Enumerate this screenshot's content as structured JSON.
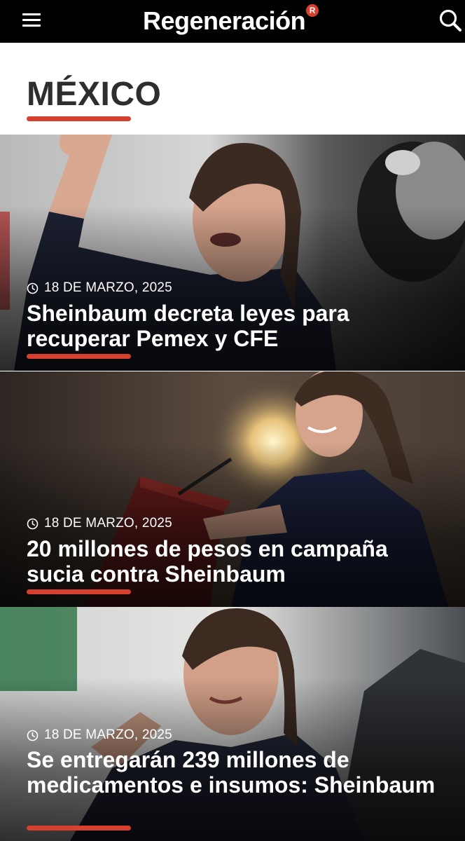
{
  "header": {
    "brand": "Regeneración",
    "brand_badge": "R",
    "menu_icon": "hamburger-menu-icon",
    "search_icon": "search-icon",
    "background": "#000000",
    "accent": "#d6402f"
  },
  "section": {
    "title": "MÉXICO"
  },
  "articles": [
    {
      "date": "18 DE MARZO, 2025",
      "title": "Sheinbaum decreta leyes para recuperar Pemex y CFE",
      "date_icon": "clock-icon"
    },
    {
      "date": "18 DE MARZO, 2025",
      "title": "20 millones de pesos en campaña sucia contra Sheinbaum",
      "date_icon": "clock-icon"
    },
    {
      "date": "18 DE MARZO, 2025",
      "title": "Se entregarán 239 millones de medicamentos e insumos: Sheinbaum",
      "date_icon": "clock-icon"
    }
  ]
}
